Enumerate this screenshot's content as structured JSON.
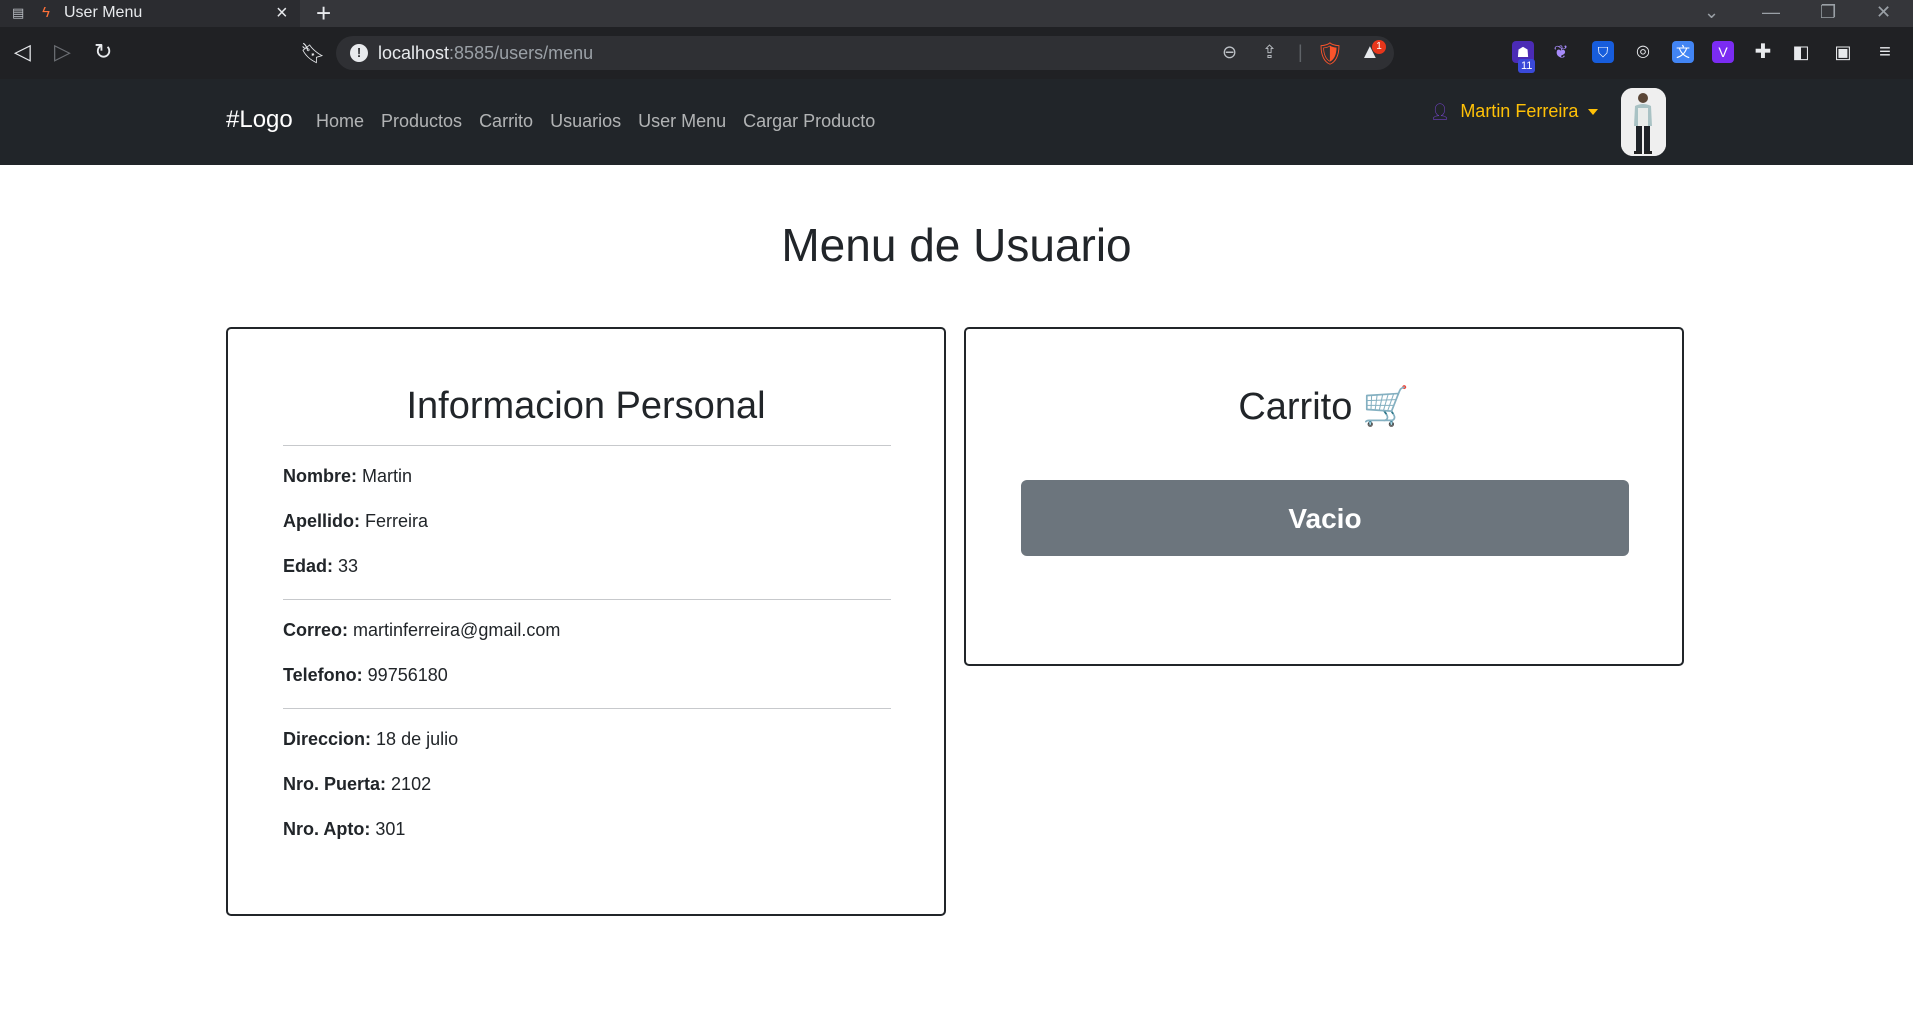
{
  "browser": {
    "tab_title": "User Menu",
    "url_host": "localhost",
    "url_rest": ":8585/users/menu",
    "extension_badge": "11",
    "rewards_badge": "1"
  },
  "navbar": {
    "brand": "#Logo",
    "links": [
      "Home",
      "Productos",
      "Carrito",
      "Usuarios",
      "User Menu",
      "Cargar Producto"
    ],
    "user_name": "Martin Ferreira",
    "accent_color": "#ffc107",
    "background_color": "#212529"
  },
  "page": {
    "title": "Menu de Usuario"
  },
  "personal_info": {
    "title": "Informacion Personal",
    "nombre_label": "Nombre:",
    "nombre": "Martin",
    "apellido_label": "Apellido:",
    "apellido": "Ferreira",
    "edad_label": "Edad:",
    "edad": "33",
    "correo_label": "Correo:",
    "correo": "martinferreira@gmail.com",
    "telefono_label": "Telefono:",
    "telefono": "99756180",
    "direccion_label": "Direccion:",
    "direccion": "18 de julio",
    "puerta_label": "Nro. Puerta:",
    "puerta": "2102",
    "apto_label": "Nro. Apto:",
    "apto": "301"
  },
  "cart": {
    "title": "Carrito",
    "emoji": "🛒",
    "empty_button": "Vacio",
    "button_color": "#6c757d"
  }
}
